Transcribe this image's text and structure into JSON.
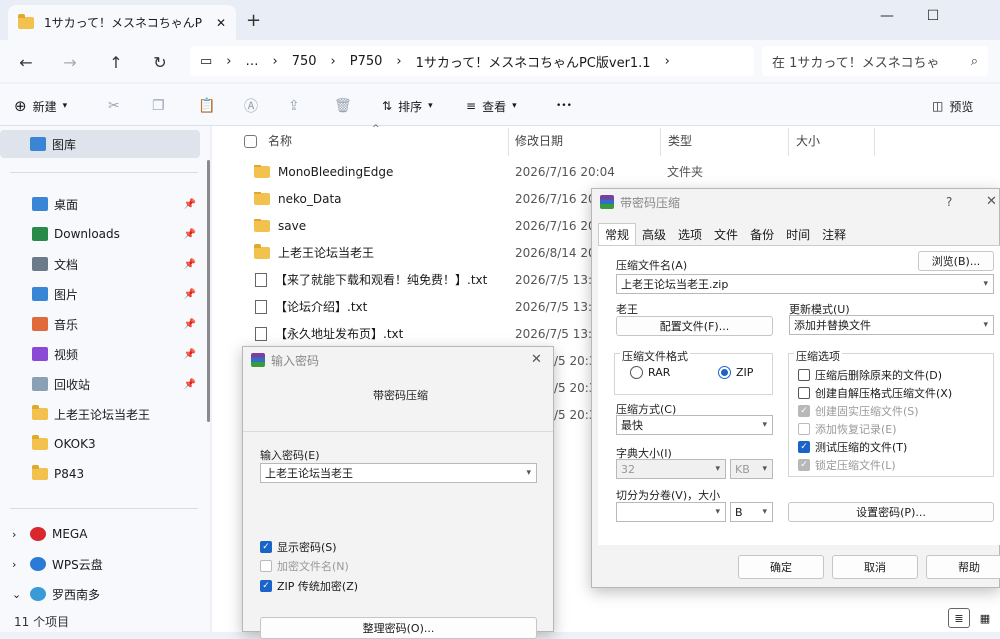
{
  "window": {
    "tab_title": "1サカって！メスネコちゃんP",
    "new_tab": "+",
    "minimize": "—",
    "maximize": "☐"
  },
  "nav": {
    "back": "←",
    "forward": "→",
    "up": "↑",
    "refresh": "↻"
  },
  "address": {
    "crumbs": [
      "…",
      "750",
      "P750",
      "1サカって！メスネコちゃんPC版ver1.1"
    ],
    "search_placeholder": "在 1サカって！メスネコちゃ"
  },
  "toolbar": {
    "new": "新建",
    "sort": "排序",
    "view": "查看",
    "more": "•••",
    "preview": "预览"
  },
  "sidebar": {
    "gallery": "图库",
    "quick": [
      {
        "label": "桌面",
        "color": "#3a86d6"
      },
      {
        "label": "Downloads",
        "color": "#2a8a4a"
      },
      {
        "label": "文档",
        "color": "#6b7b8c"
      },
      {
        "label": "图片",
        "color": "#3a86d6"
      },
      {
        "label": "音乐",
        "color": "#e06a3a"
      },
      {
        "label": "视频",
        "color": "#8a4ad6"
      },
      {
        "label": "回收站",
        "color": "#8aa0b4"
      }
    ],
    "folders": [
      "上老王论坛当老王",
      "OKOK3",
      "P843"
    ],
    "drives": [
      {
        "label": "MEGA",
        "color": "#d9272e"
      },
      {
        "label": "WPS云盘",
        "color": "#2a7ad6"
      },
      {
        "label": "罗西南多",
        "color": "#3a9ad6"
      }
    ]
  },
  "status": {
    "count": "11 个项目"
  },
  "columns": {
    "name": "名称",
    "date": "修改日期",
    "type": "类型",
    "size": "大小"
  },
  "files": [
    {
      "name": "MonoBleedingEdge",
      "date": "2026/7/16 20:04",
      "type": "文件夹",
      "kind": "folder"
    },
    {
      "name": "neko_Data",
      "date": "2026/7/16 20",
      "type": "",
      "kind": "folder"
    },
    {
      "name": "save",
      "date": "2026/7/16 20",
      "type": "",
      "kind": "folder"
    },
    {
      "name": "上老王论坛当老王",
      "date": "2026/8/14 20",
      "type": "",
      "kind": "folder"
    },
    {
      "name": "【来了就能下载和观看！纯免费！】.txt",
      "date": "2026/7/5 13:1",
      "type": "",
      "kind": "txt"
    },
    {
      "name": "【论坛介绍】.txt",
      "date": "2026/7/5 13:1",
      "type": "",
      "kind": "txt"
    },
    {
      "name": "【永久地址发布页】.txt",
      "date": "2026/7/5 13:1",
      "type": "",
      "kind": "txt"
    }
  ],
  "hidden_dates": [
    "/5 20:3",
    "/5 20:3",
    "/5 20:3"
  ],
  "password_dialog": {
    "title": "输入密码",
    "heading": "带密码压缩",
    "label": "输入密码(E)",
    "value": "上老王论坛当老王",
    "show_password": "显示密码(S)",
    "encrypt_names": "加密文件名(N)",
    "zip_legacy": "ZIP 传统加密(Z)",
    "organize": "整理密码(O)..."
  },
  "archive_dialog": {
    "title": "带密码压缩",
    "help_q": "?",
    "tabs": [
      "常规",
      "高级",
      "选项",
      "文件",
      "备份",
      "时间",
      "注释"
    ],
    "archive_name_label": "压缩文件名(A)",
    "browse": "浏览(B)...",
    "archive_name": "上老王论坛当老王.zip",
    "profile_label": "老王",
    "profile_btn": "配置文件(F)...",
    "update_label": "更新模式(U)",
    "update_value": "添加并替换文件",
    "format_label": "压缩文件格式",
    "format_rar": "RAR",
    "format_zip": "ZIP",
    "method_label": "压缩方式(C)",
    "method_value": "最快",
    "dict_label": "字典大小(I)",
    "dict_value": "32",
    "dict_unit": "KB",
    "split_label": "切分为分卷(V)，大小",
    "split_unit": "B",
    "options_label": "压缩选项",
    "opts": [
      {
        "label": "压缩后删除原来的文件(D)",
        "state": "off"
      },
      {
        "label": "创建自解压格式压缩文件(X)",
        "state": "off"
      },
      {
        "label": "创建固实压缩文件(S)",
        "state": "grey"
      },
      {
        "label": "添加恢复记录(E)",
        "state": "disoff"
      },
      {
        "label": "测试压缩的文件(T)",
        "state": "on"
      },
      {
        "label": "锁定压缩文件(L)",
        "state": "grey"
      }
    ],
    "set_password": "设置密码(P)...",
    "ok": "确定",
    "cancel": "取消",
    "help": "帮助"
  }
}
